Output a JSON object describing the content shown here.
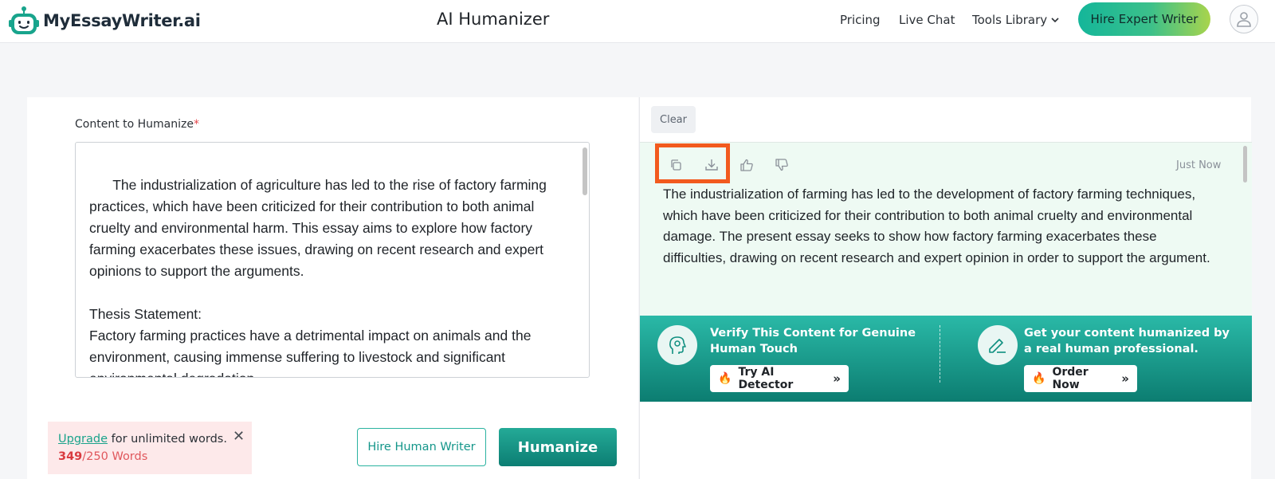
{
  "brand": {
    "name": "MyEssayWriter.ai"
  },
  "header": {
    "title": "AI Humanizer",
    "nav": {
      "pricing": "Pricing",
      "live_chat": "Live Chat",
      "tools_library": "Tools Library"
    },
    "cta": "Hire Expert Writer"
  },
  "input": {
    "label": "Content to Humanize",
    "required_mark": "*",
    "text": "      The industrialization of agriculture has led to the rise of factory farming practices, which have been criticized for their contribution to both animal cruelty and environmental harm. This essay aims to explore how factory farming exacerbates these issues, drawing on recent research and expert opinions to support the arguments.\n\nThesis Statement:\nFactory farming practices have a detrimental impact on animals and the environment, causing immense suffering to livestock and significant environmental degradation."
  },
  "limit": {
    "upgrade_link": "Upgrade",
    "upgrade_text": " for unlimited words.",
    "count": "349",
    "limit_text": "/250 Words",
    "close": "✕"
  },
  "actions": {
    "hire_human": "Hire Human Writer",
    "humanize": "Humanize"
  },
  "output": {
    "clear": "Clear",
    "timestamp": "Just Now",
    "text": "The industrialization of farming has led to the development of factory farming techniques, which have been criticized for their contribution to both animal cruelty and environmental damage. The present essay seeks to show how factory farming exacerbates these difficulties, drawing on recent research and expert opinion in order to support the argument.",
    "icons": [
      "copy-icon",
      "download-icon",
      "thumbs-up-icon",
      "thumbs-down-icon"
    ]
  },
  "promo": {
    "detector_title": "Verify This Content for Genuine Human Touch",
    "detector_button": "Try AI Detector",
    "order_title": "Get your content humanized by a real human professional.",
    "order_button": "Order Now",
    "fire": "🔥",
    "chevron": "»"
  },
  "colors": {
    "accent": "#1aa38b",
    "highlight": "#f25a1e",
    "output_bg": "#eefaf3",
    "warning_bg": "#fde9ea"
  }
}
